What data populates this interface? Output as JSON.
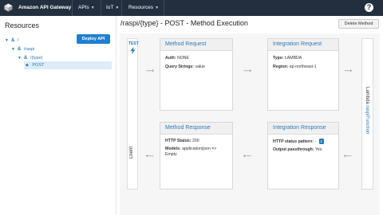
{
  "topbar": {
    "brand": "Amazon API Gateway",
    "menus": [
      {
        "label": "APIs"
      },
      {
        "label": "IoT"
      },
      {
        "label": "Resources"
      }
    ],
    "help_symbol": "?"
  },
  "resources": {
    "title": "Resources",
    "deploy_label": "Deploy API",
    "tree": [
      {
        "label": "/",
        "level": 0
      },
      {
        "label": "/raspi",
        "level": 1
      },
      {
        "label": "/{type}",
        "level": 2
      },
      {
        "label": "POST",
        "level": 3,
        "selected": true
      }
    ]
  },
  "main": {
    "title": "/raspi/{type} - POST - Method Execution",
    "delete_label": "Delete Method",
    "client": {
      "test_label": "TEST",
      "label": "Client"
    },
    "lambda": {
      "prefix": "Lambda",
      "function": "raspiFunction"
    },
    "method_request": {
      "title": "Method Request",
      "auth_label": "Auth:",
      "auth_value": "NONE",
      "qs_label": "Query Strings:",
      "qs_value": "value"
    },
    "integration_request": {
      "title": "Integration Request",
      "type_label": "Type:",
      "type_value": "LAMBDA",
      "region_label": "Region:",
      "region_value": "ap-northeast-1"
    },
    "method_response": {
      "title": "Method Response",
      "status_label": "HTTP Status:",
      "status_value": "200",
      "models_label": "Models:",
      "models_value": "application/json => Empty"
    },
    "integration_response": {
      "title": "Integration Response",
      "pattern_label": "HTTP status pattern:",
      "pattern_value": "-",
      "passthrough_label": "Output passthrough:",
      "passthrough_value": "Yes"
    }
  },
  "colors": {
    "nav_bg": "#232f3e",
    "accent": "#2a7ab8",
    "button_blue": "#1f7fd1",
    "canvas_bg": "#f6f6f6"
  },
  "icons": {
    "logo": "aws-cube-icon",
    "help": "help-icon",
    "resource": "resource-icon",
    "method": "method-icon",
    "test": "lightning-icon",
    "arrows": "arrow-right-icon"
  }
}
